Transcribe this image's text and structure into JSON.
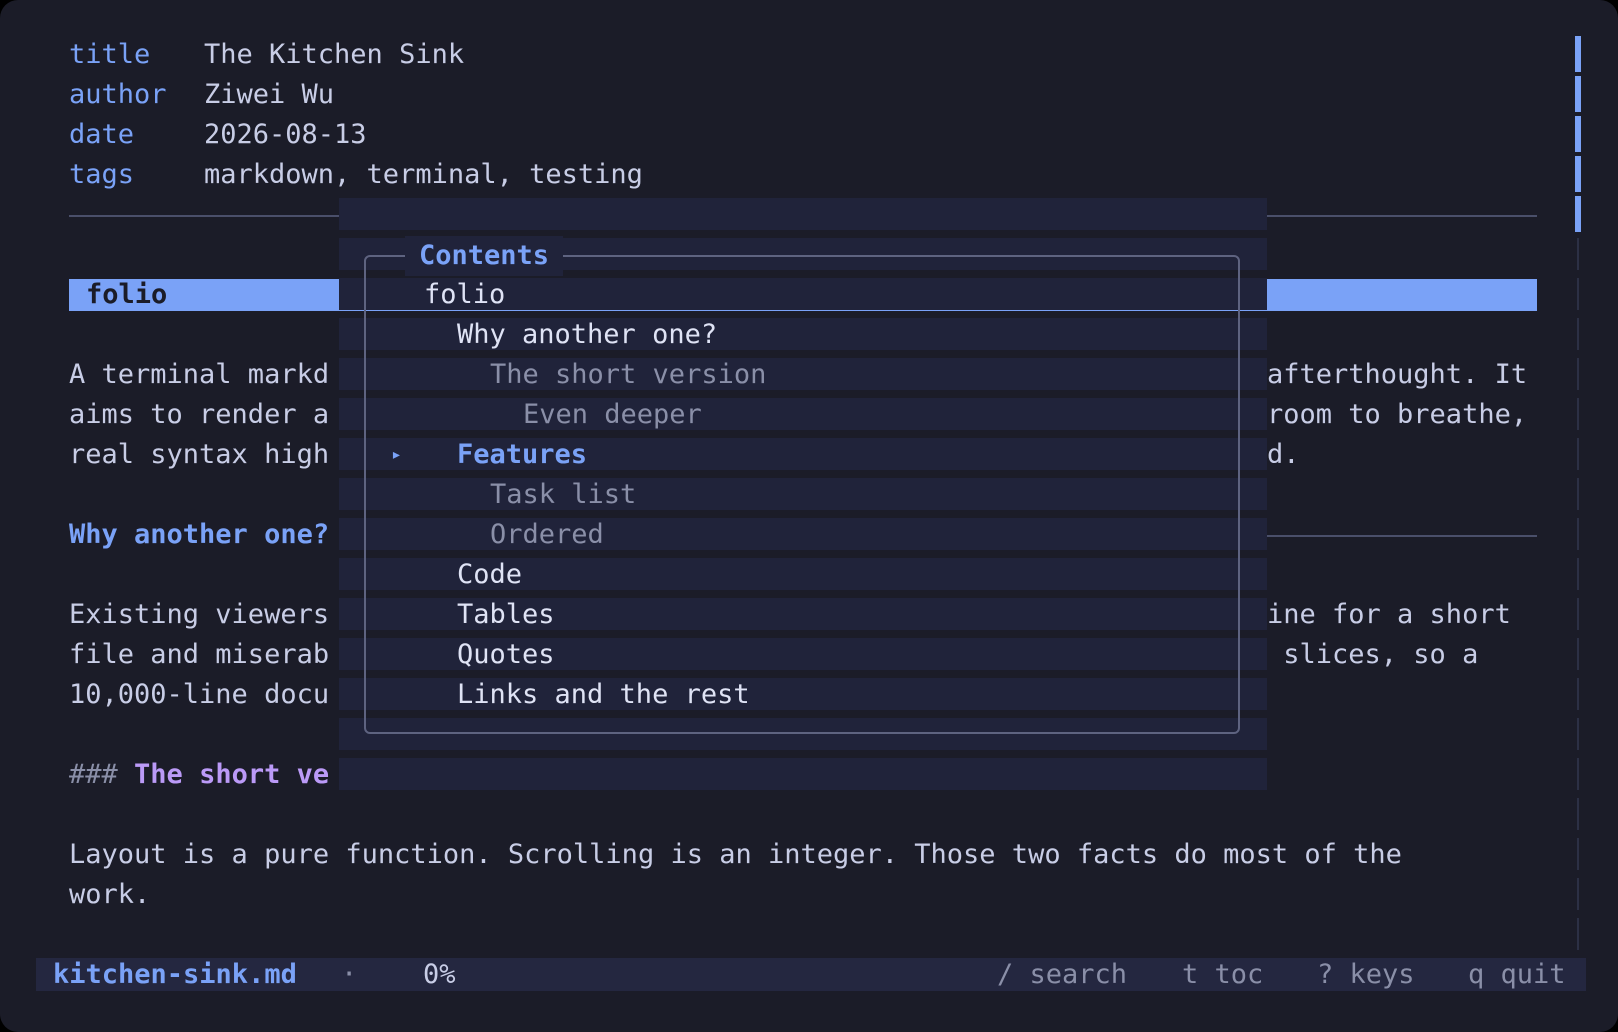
{
  "frontmatter": [
    {
      "key": "title",
      "value": "The Kitchen Sink"
    },
    {
      "key": "author",
      "value": "Ziwei Wu"
    },
    {
      "key": "date",
      "value": "2026-08-13"
    },
    {
      "key": "tags",
      "value": "markdown, terminal, testing"
    }
  ],
  "document": {
    "h1": "folio",
    "para1": [
      "A terminal markd",
      "aims to render a",
      "real syntax high"
    ],
    "para1_right": [
      "afterthought. It",
      "room to breathe,",
      "d."
    ],
    "h2_why": "Why another one?",
    "para2": [
      "Existing viewers",
      "file and miserab",
      "10,000-line docu"
    ],
    "para2_right": [
      "ine for a short",
      " slices, so a",
      ""
    ],
    "h3_marker": "###",
    "h3_short": "The short ve",
    "para3": [
      "Layout is a pure function. Scrolling is an integer. Those two facts do most of the",
      "work."
    ]
  },
  "toc": {
    "title": "Contents",
    "marker": "▸",
    "items": [
      {
        "label": "folio",
        "level": 0
      },
      {
        "label": "Why another one?",
        "level": 1
      },
      {
        "label": "The short version",
        "level": 2
      },
      {
        "label": "Even deeper",
        "level": 3
      },
      {
        "label": "Features",
        "level": 1
      },
      {
        "label": "Task list",
        "level": 2
      },
      {
        "label": "Ordered",
        "level": 2
      },
      {
        "label": "Code",
        "level": 1
      },
      {
        "label": "Tables",
        "level": 1
      },
      {
        "label": "Quotes",
        "level": 1
      },
      {
        "label": "Links and the rest",
        "level": 1
      }
    ],
    "selected_index": 4
  },
  "statusbar": {
    "filename": "kitchen-sink.md",
    "separator": "·",
    "progress": "0%",
    "hints": [
      "/ search",
      "t toc",
      "? keys",
      "q quit"
    ]
  },
  "colors": {
    "background": "#1b1c28",
    "accent": "#7aa2f7",
    "heading3": "#bb9af7",
    "text": "#c8cde6",
    "muted": "#8a8fa8"
  }
}
